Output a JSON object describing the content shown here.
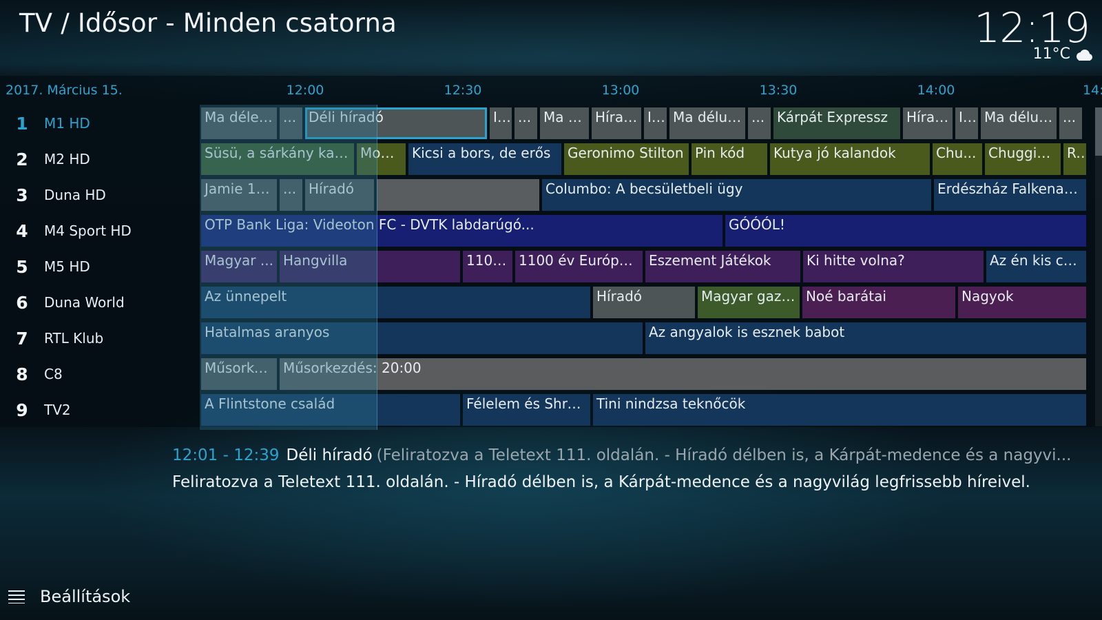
{
  "header": {
    "title": "TV / Idősor - Minden csatorna",
    "clock": "12:19",
    "temperature": "11°C",
    "weather_icon": "cloud-icon"
  },
  "guide": {
    "date": "2017. Március 15.",
    "time_labels": [
      "12:00",
      "12:30",
      "13:00",
      "13:30",
      "14:00",
      "14:"
    ],
    "channels": [
      {
        "number": "1",
        "name": "M1 HD"
      },
      {
        "number": "2",
        "name": "M2 HD"
      },
      {
        "number": "3",
        "name": "Duna HD"
      },
      {
        "number": "4",
        "name": "M4 Sport HD"
      },
      {
        "number": "5",
        "name": "M5 HD"
      },
      {
        "number": "6",
        "name": "Duna World"
      },
      {
        "number": "7",
        "name": "RTL Klub"
      },
      {
        "number": "8",
        "name": "C8"
      },
      {
        "number": "9",
        "name": "TV2"
      }
    ],
    "programs": [
      [
        "Ma délel...",
        "...",
        "Déli híradó",
        "I...",
        "...",
        "Ma d...",
        "Híradó",
        "I...",
        "Ma délut...",
        "...",
        "Kárpát Expressz",
        "Híradó",
        "I...",
        "Ma délut...",
        "..."
      ],
      [
        "Süsü, a sárkány kala...",
        "Mon...",
        "Kicsi a bors, de erős",
        "Geronimo Stilton",
        "Pin kód",
        "Kutya jó kalandok",
        "Chu...",
        "Chuggin...",
        "R..."
      ],
      [
        "Jamie 15...",
        "...",
        "Híradó",
        "",
        "Columbo: A becsületbeli ügy",
        "Erdészház Falkenaubar"
      ],
      [
        "OTP Bank Liga: Videoton FC - DVTK labdarúgó...",
        "GÓÓÓL!"
      ],
      [
        "Magyar ...",
        "Hangvilla",
        "1100...",
        "1100 év Európa ...",
        "Eszement Játékok",
        "Ki hitte volna?",
        "Az én kis család"
      ],
      [
        "Az ünnepelt",
        "Híradó",
        "Magyar gazda",
        "Noé barátai",
        "Nagyok"
      ],
      [
        "Hatalmas aranyos",
        "Az angyalok is esznek babot"
      ],
      [
        "Műsorke...",
        "Műsorkezdés: 20:00"
      ],
      [
        "A Flintstone család",
        "Félelem és Shre...",
        "Tini nindzsa teknőcök"
      ]
    ],
    "active_channel": "1",
    "selected_program": "Déli híradó"
  },
  "info": {
    "time_range": "12:01 - 12:39",
    "title": "Déli híradó",
    "subtitle": "(Feliratozva a Teletext 111. oldalán.  - Híradó délben is, a Kárpát-medence és a nagyvi...",
    "description": "Feliratozva a Teletext 111. oldalán.  - Híradó délben is, a Kárpát-medence és a nagyvilág legfrissebb híreivel."
  },
  "footer": {
    "settings_label": "Beállítások",
    "settings_icon": "hamburger-icon"
  },
  "colors": {
    "accent": "#2ba3cf",
    "news": "#4d5557",
    "kids": "#4a5a1c",
    "movie": "#13365a",
    "sport": "#161f72",
    "culture": "#3e1f5a"
  }
}
